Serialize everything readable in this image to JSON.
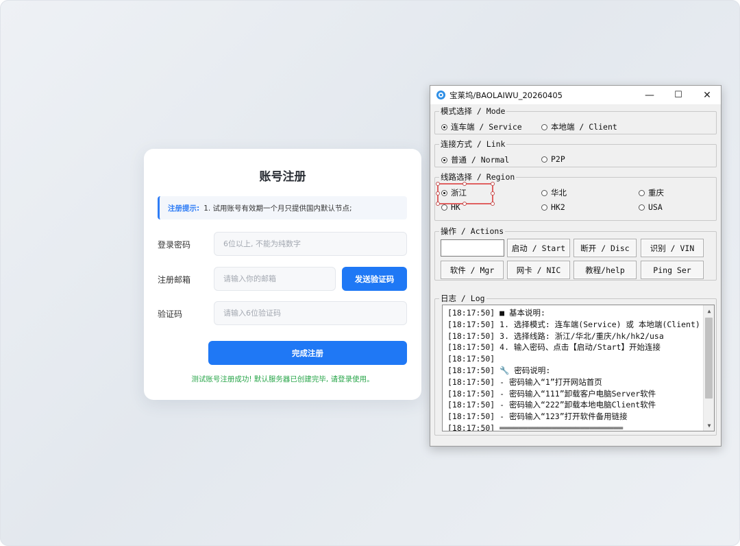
{
  "register": {
    "title": "账号注册",
    "tip_label": "注册提示:",
    "tip_text": "1. 试用账号有效期一个月只提供国内默认节点;",
    "password_label": "登录密码",
    "password_placeholder": "6位以上, 不能为纯数字",
    "email_label": "注册邮箱",
    "email_placeholder": "请输入你的邮箱",
    "send_code_label": "发送验证码",
    "code_label": "验证码",
    "code_placeholder": "请输入6位验证码",
    "submit_label": "完成注册",
    "success_message": "测试账号注册成功! 默认服务器已创建完毕, 请登录使用。",
    "accent_color": "#1f78f5",
    "success_color": "#29a64a"
  },
  "window": {
    "title": "宝莱坞/BAOLAIWU_20260405",
    "minimize_icon": "—",
    "maximize_icon": "☐",
    "close_icon": "✕",
    "mode": {
      "legend": "模式选择 / Mode",
      "options": [
        {
          "label": "连车端 / Service",
          "selected": true
        },
        {
          "label": "本地端 / Client",
          "selected": false
        }
      ]
    },
    "link": {
      "legend": "连接方式 / Link",
      "options": [
        {
          "label": "普通 / Normal",
          "selected": true
        },
        {
          "label": "P2P",
          "selected": false
        }
      ]
    },
    "region": {
      "legend": "线路选择 / Region",
      "options": [
        {
          "label": "浙江",
          "selected": true
        },
        {
          "label": "华北",
          "selected": false
        },
        {
          "label": "重庆",
          "selected": false
        },
        {
          "label": "HK",
          "selected": false
        },
        {
          "label": "HK2",
          "selected": false
        },
        {
          "label": "USA",
          "selected": false
        }
      ]
    },
    "actions": {
      "legend": "操作 / Actions",
      "input_value": "",
      "buttons": [
        "启动 / Start",
        "断开 / Disc",
        "识别 / VIN",
        "软件 / Mgr",
        "网卡 / NIC",
        "教程/help",
        "Ping Ser"
      ]
    },
    "log": {
      "legend": "日志 / Log",
      "lines": [
        "[18:17:50] ■ 基本说明:",
        "[18:17:50] 1. 选择模式: 连车端(Service) 或 本地端(Client)",
        "[18:17:50] 3. 选择线路: 浙江/华北/重庆/hk/hk2/usa",
        "[18:17:50] 4. 输入密码、点击【启动/Start】开始连接",
        "[18:17:50]",
        "[18:17:50] 🔧 密码说明:",
        "[18:17:50] - 密码输入“1”打开网站首页",
        "[18:17:50] - 密码输入“111”卸载客户电脑Server软件",
        "[18:17:50] - 密码输入“222”卸载本地电脑Client软件",
        "[18:17:50] - 密码输入“123”打开软件备用链接",
        "[18:17:50] ══════════════════════════"
      ]
    }
  }
}
